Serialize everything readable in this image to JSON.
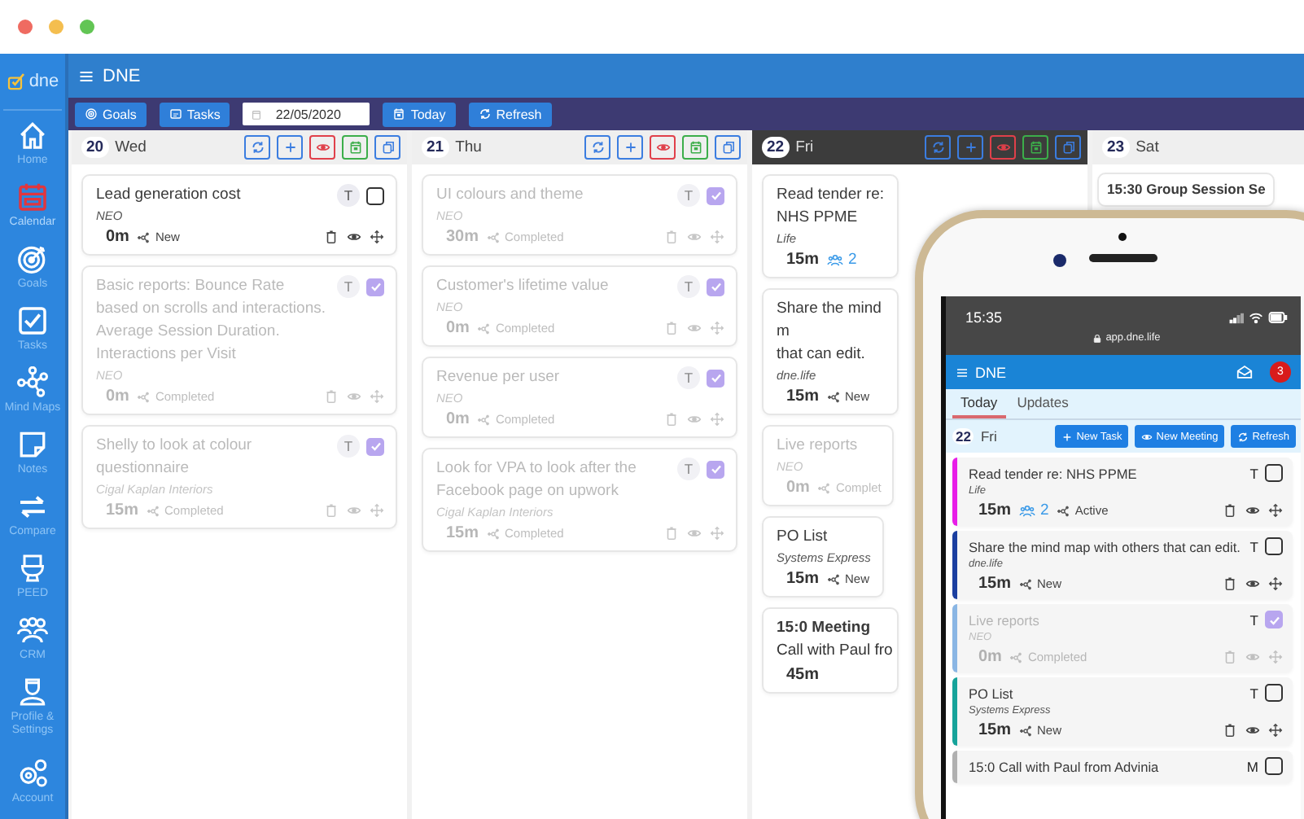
{
  "sidebar": {
    "logo": "dne",
    "items": [
      {
        "label": "Home",
        "selected": false
      },
      {
        "label": "Calendar",
        "selected": true
      },
      {
        "label": "Goals",
        "selected": false
      },
      {
        "label": "Tasks",
        "selected": false
      },
      {
        "label": "Mind Maps",
        "selected": false
      },
      {
        "label": "Notes",
        "selected": false
      },
      {
        "label": "Compare",
        "selected": false
      },
      {
        "label": "PEED",
        "selected": false
      },
      {
        "label": "CRM",
        "selected": false
      },
      {
        "label": "Profile & Settings",
        "selected": false
      },
      {
        "label": "Account",
        "selected": false
      }
    ]
  },
  "app_bar": {
    "title": "DNE"
  },
  "toolbar": {
    "items": [
      {
        "kind": "button",
        "label": "Goals"
      },
      {
        "kind": "button",
        "label": "Tasks"
      },
      {
        "kind": "date",
        "value": "22/05/2020"
      },
      {
        "kind": "button",
        "label": "Today"
      },
      {
        "kind": "button",
        "label": "Refresh"
      }
    ]
  },
  "days": [
    {
      "number": "20",
      "name": "Wed",
      "selected": false,
      "cards": [
        {
          "kind": "task",
          "title": "Lead generation cost",
          "project": "NEO",
          "duration": "0m",
          "status": "New",
          "badge": "T",
          "completed": false
        },
        {
          "kind": "task",
          "title": "Basic reports: Bounce Rate based on scrolls and interactions. Average Session Duration. Interactions per Visit",
          "project": "NEO",
          "duration": "0m",
          "status": "Completed",
          "badge": "T",
          "completed": true
        },
        {
          "kind": "task",
          "title": "Shelly to look at colour questionnaire",
          "project": "Cigal Kaplan Interiors",
          "duration": "15m",
          "status": "Completed",
          "badge": "T",
          "completed": true
        }
      ]
    },
    {
      "number": "21",
      "name": "Thu",
      "selected": false,
      "cards": [
        {
          "kind": "task",
          "title": "UI colours and theme",
          "project": "NEO",
          "duration": "30m",
          "status": "Completed",
          "badge": "T",
          "completed": true
        },
        {
          "kind": "task",
          "title": "Customer's lifetime value",
          "project": "NEO",
          "duration": "0m",
          "status": "Completed",
          "badge": "T",
          "completed": true
        },
        {
          "kind": "task",
          "title": "Revenue per user",
          "project": "NEO",
          "duration": "0m",
          "status": "Completed",
          "badge": "T",
          "completed": true
        },
        {
          "kind": "task",
          "title": "Look for VPA to look after the Facebook page on upwork",
          "project": "Cigal Kaplan Interiors",
          "duration": "15m",
          "status": "Completed",
          "badge": "T",
          "completed": true
        }
      ]
    },
    {
      "number": "22",
      "name": "Fri",
      "selected": true,
      "cards": [
        {
          "kind": "task",
          "title": "Read tender re: NHS PPME",
          "project": "Life",
          "duration": "15m",
          "participants": "2",
          "completed": false
        },
        {
          "kind": "task",
          "title": "Share the mind m\nthat can edit.",
          "project": "dne.life",
          "duration": "15m",
          "status": "New",
          "completed": false
        },
        {
          "kind": "task",
          "title": "Live reports",
          "project": "NEO",
          "duration": "0m",
          "status": "Complet",
          "completed": true
        },
        {
          "kind": "task",
          "title": "PO List",
          "project": "Systems Express",
          "duration": "15m",
          "status": "New",
          "completed": false
        },
        {
          "kind": "meeting",
          "title": "15:0 Meeting",
          "subtitle": "Call with Paul fro",
          "duration": "45m"
        }
      ]
    },
    {
      "number": "23",
      "name": "Sat",
      "selected": false,
      "cards": [
        {
          "kind": "meeting",
          "title": "15:30 Group Session Se"
        }
      ]
    }
  ],
  "phone": {
    "time": "15:35",
    "url": "app.dne.life",
    "title": "DNE",
    "notifications": "3",
    "tabs": [
      {
        "label": "Today",
        "selected": true
      },
      {
        "label": "Updates",
        "selected": false
      }
    ],
    "day": {
      "number": "22",
      "name": "Fri"
    },
    "buttons": [
      "New Task",
      "New Meeting",
      "Refresh"
    ],
    "cards": [
      {
        "title": "Read tender re: NHS PPME",
        "project": "Life",
        "duration": "15m",
        "participants": "2",
        "status": "Active",
        "badge": "T",
        "completed": false,
        "color": "#e81ee8"
      },
      {
        "title": "Share the mind map with others that can edit.",
        "project": "dne.life",
        "duration": "15m",
        "status": "New",
        "badge": "T",
        "completed": false,
        "color": "#1b3fa0"
      },
      {
        "title": "Live reports",
        "project": "NEO",
        "duration": "0m",
        "status": "Completed",
        "badge": "T",
        "completed": true,
        "color": "#8ab6e4"
      },
      {
        "title": "PO List",
        "project": "Systems Express",
        "duration": "15m",
        "status": "New",
        "badge": "T",
        "completed": false,
        "color": "#16a39a"
      },
      {
        "title": "15:0  Call with Paul from Advinia",
        "badge": "M",
        "completed": false,
        "color": "#b0b0b0"
      }
    ]
  }
}
